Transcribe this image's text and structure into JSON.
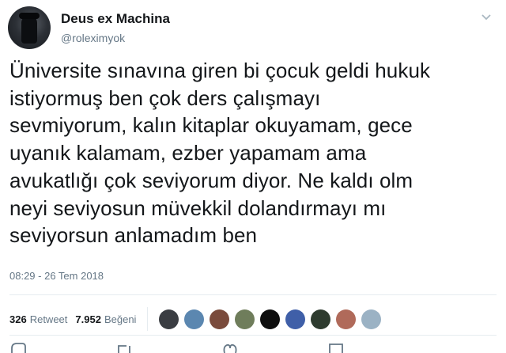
{
  "user": {
    "display_name": "Deus ex Machina",
    "handle": "@roleximyok"
  },
  "tweet": {
    "lines": [
      "Üniversite sınavına giren bi çocuk geldi hukuk",
      "istiyormuş ben çok ders çalışmayı",
      "sevmiyorum, kalın kitaplar okuyamam, gece",
      "uyanık kalamam, ezber yapamam ama",
      "avukatlığı çok seviyorum diyor. Ne kaldı olm",
      "neyi seviyosun müvekkil dolandırmayı mı",
      "seviyorsun anlamadım ben"
    ],
    "timestamp": "08:29 - 26 Tem 2018"
  },
  "stats": {
    "retweet_count": "326",
    "retweet_label": "Retweet",
    "like_count": "7.952",
    "like_label": "Beğeni"
  },
  "likers": [
    {
      "name": "liker-avatar-1",
      "color": "#3a3d42"
    },
    {
      "name": "liker-avatar-2",
      "color": "#5b87b0"
    },
    {
      "name": "liker-avatar-3",
      "color": "#7a4b3c"
    },
    {
      "name": "liker-avatar-4",
      "color": "#6f7d5b"
    },
    {
      "name": "liker-avatar-5",
      "color": "#0e0e0e"
    },
    {
      "name": "liker-avatar-6",
      "color": "#3f5fa8"
    },
    {
      "name": "liker-avatar-7",
      "color": "#2e3b2f"
    },
    {
      "name": "liker-avatar-8",
      "color": "#b06a5a"
    },
    {
      "name": "liker-avatar-9",
      "color": "#9bb2c4"
    }
  ],
  "icons": {
    "menu": "chevron-down-icon",
    "actions": [
      "reply-icon",
      "retweet-icon",
      "like-icon",
      "message-icon"
    ]
  },
  "colors": {
    "text": "#14171a",
    "secondary": "#657786",
    "divider": "#e6ecf0"
  }
}
